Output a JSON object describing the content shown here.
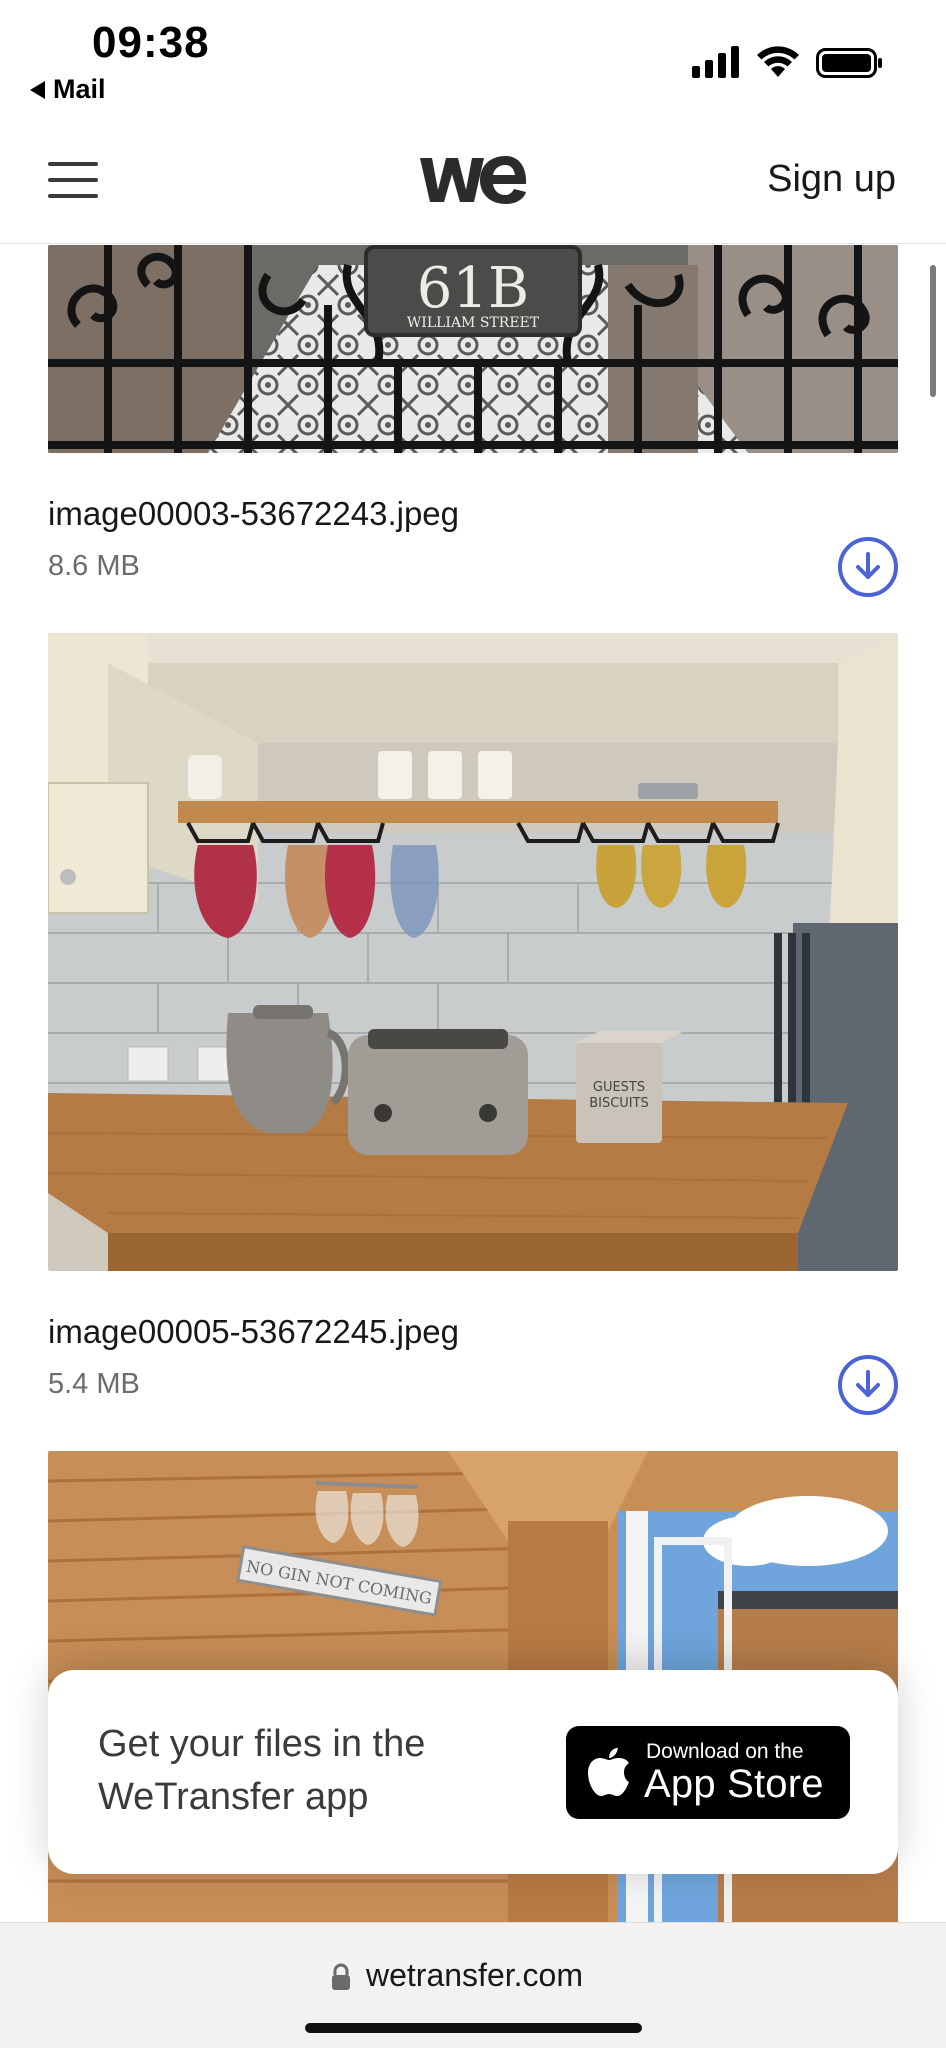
{
  "status_bar": {
    "time": "09:38",
    "back_label": "Mail",
    "icons": [
      "cellular-signal-icon",
      "wifi-icon",
      "battery-icon"
    ]
  },
  "header": {
    "logo_icon": "wetransfer-logo-icon",
    "menu_icon": "hamburger-menu-icon",
    "signup_label": "Sign up"
  },
  "files": [
    {
      "name": "image00003-53672243.jpeg",
      "size": "8.6 MB",
      "preview_sign_number": "61B",
      "preview_sign_street": "WILLIAM STREET",
      "download_icon": "download-circle-icon"
    },
    {
      "name": "image00005-53672245.jpeg",
      "size": "5.4 MB",
      "download_icon": "download-circle-icon"
    },
    {
      "preview_sign_text": "NO GIN NOT COMING"
    }
  ],
  "app_banner": {
    "text": "Get your files in the WeTransfer app",
    "store_small": "Download on the",
    "store_big": "App Store",
    "store_icon": "apple-logo-icon"
  },
  "url_bar": {
    "url": "wetransfer.com",
    "lock_icon": "lock-icon"
  },
  "colors": {
    "accent": "#4a63d6",
    "text": "#17181a",
    "muted": "#6c6c6c"
  }
}
